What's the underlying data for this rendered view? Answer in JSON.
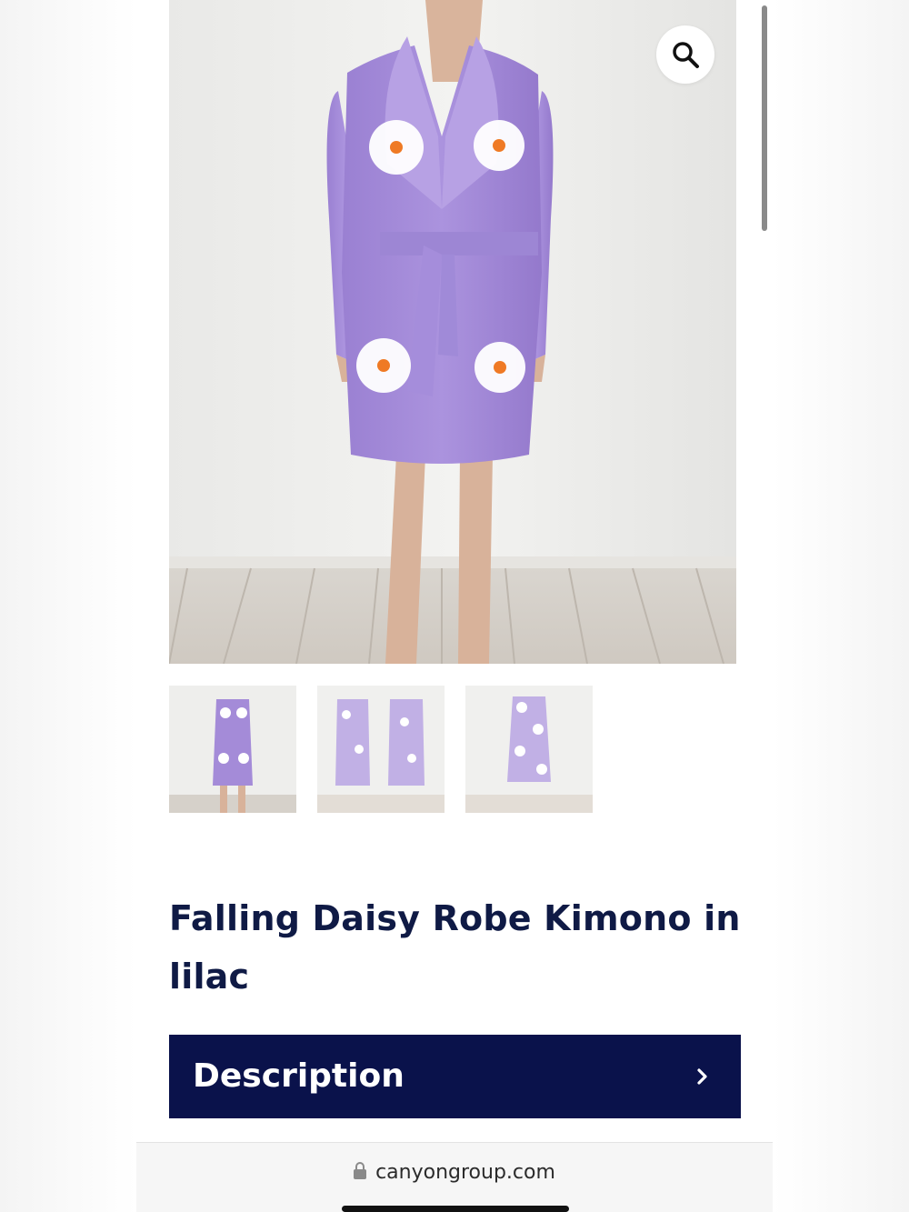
{
  "product": {
    "title": "Falling Daisy Robe Kimono in lilac",
    "main_image_alt": "Falling Daisy Robe Kimono in lilac",
    "thumbnails": [
      {
        "alt": "front view",
        "selected": true
      },
      {
        "alt": "front and back view",
        "selected": false
      },
      {
        "alt": "back view",
        "selected": false
      }
    ],
    "zoom_icon": "magnifier-icon"
  },
  "accordion": {
    "description_label": "Description",
    "chevron_icon": "chevron-right-icon"
  },
  "browser": {
    "url": "canyongroup.com",
    "lock_icon": "lock-icon"
  },
  "colors": {
    "title": "#0f1a45",
    "description_bar": "#0a124b",
    "robe": "#a48bd8"
  }
}
